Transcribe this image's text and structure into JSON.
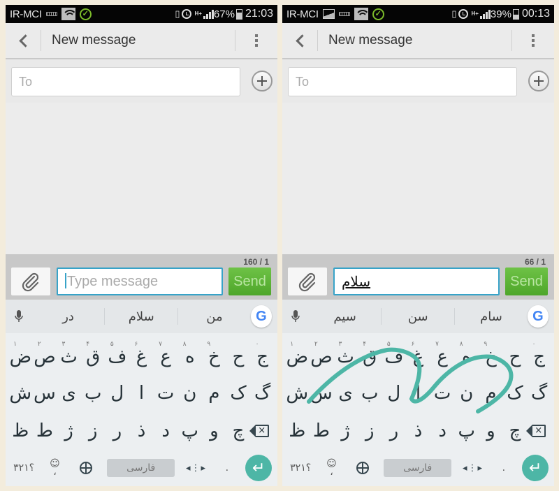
{
  "screens": [
    {
      "status": {
        "carrier": "IR-MCI",
        "battery": "67%",
        "battery_level": 0.67,
        "time": "21:03",
        "network": "H+"
      },
      "header": {
        "title": "New message"
      },
      "recipient": {
        "placeholder": "To"
      },
      "composer": {
        "counter": "160 / 1",
        "placeholder": "Type message",
        "value": "",
        "send_label": "Send"
      },
      "suggestions": [
        "در",
        "سلام",
        "من"
      ]
    },
    {
      "status": {
        "carrier": "IR-MCI",
        "battery": "39%",
        "battery_level": 0.39,
        "time": "00:13",
        "network": "H+"
      },
      "header": {
        "title": "New message"
      },
      "recipient": {
        "placeholder": "To"
      },
      "composer": {
        "counter": "66 / 1",
        "placeholder": "",
        "value": "سلام",
        "send_label": "Send"
      },
      "suggestions": [
        "سیم",
        "سن",
        "سام"
      ]
    }
  ],
  "keyboard": {
    "row1": [
      {
        "k": "ج",
        "h": "۰"
      },
      {
        "k": "ح",
        "h": ""
      },
      {
        "k": "خ",
        "h": "۹"
      },
      {
        "k": "ه",
        "h": "۸"
      },
      {
        "k": "ع",
        "h": "۷"
      },
      {
        "k": "غ",
        "h": "۶"
      },
      {
        "k": "ف",
        "h": "۵"
      },
      {
        "k": "ق",
        "h": "۴"
      },
      {
        "k": "ث",
        "h": "۳"
      },
      {
        "k": "ص",
        "h": "۲"
      },
      {
        "k": "ض",
        "h": "۱"
      }
    ],
    "row2": [
      "گ",
      "ک",
      "م",
      "ن",
      "ت",
      "ا",
      "ل",
      "ب",
      "ی",
      "س",
      "ش"
    ],
    "row3": [
      "چ",
      "و",
      "پ",
      "د",
      "ذ",
      "ر",
      "ز",
      "ژ",
      "ط",
      "ظ"
    ],
    "symbols_label": "؟۳۲۱",
    "space_label": "فارسی",
    "period": ".",
    "emoji_comma": "،"
  },
  "swipe_trail_color": "#4db6a6",
  "accent_color": "#38a3c8",
  "send_color": "#5cb535"
}
